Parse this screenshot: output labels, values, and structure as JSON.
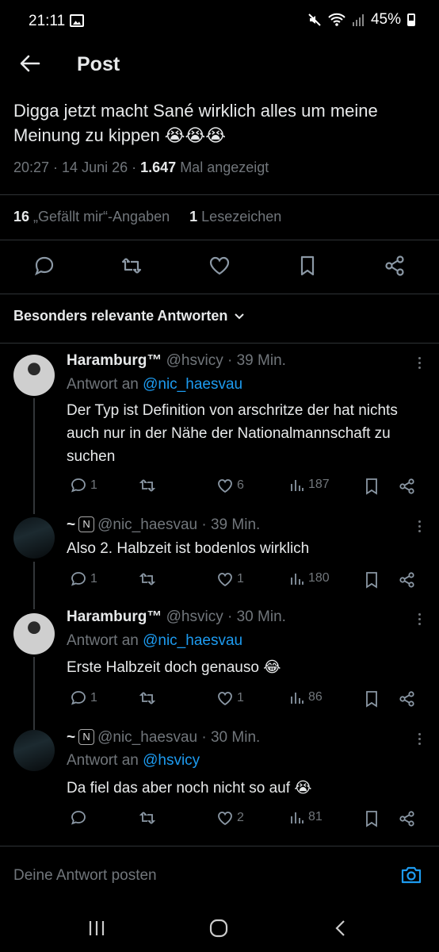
{
  "status_bar": {
    "time": "21:11",
    "battery": "45%"
  },
  "header": {
    "title": "Post"
  },
  "post": {
    "text": "Digga jetzt macht Sané wirklich alles um meine Meinung zu kippen 😭😭😭",
    "time": "20:27",
    "date": "14 Juni 26",
    "views_count": "1.647",
    "views_label": "Mal angezeigt",
    "likes_count": "16",
    "likes_label": "„Gefällt mir“-Angaben",
    "bookmarks_count": "1",
    "bookmarks_label": "Lesezeichen"
  },
  "sort": {
    "label": "Besonders relevante Antworten"
  },
  "replies": [
    {
      "name": "Haramburg™",
      "handle": "@hsvicy",
      "time": "· 39 Min.",
      "reply_to_label": "Antwort an",
      "reply_to": "@nic_haesvau",
      "text": "Der Typ ist Definition von arschritze der hat nichts auch nur in der Nähe der Nationalmannschaft zu suchen",
      "comments": "1",
      "retweets": "",
      "likes": "6",
      "views": "187"
    },
    {
      "name": "~",
      "badge": "N",
      "handle": "@nic_haesvau",
      "time": "· 39 Min.",
      "text": "Also 2. Halbzeit ist bodenlos wirklich",
      "comments": "1",
      "retweets": "",
      "likes": "1",
      "views": "180"
    },
    {
      "name": "Haramburg™",
      "handle": "@hsvicy",
      "time": "· 30 Min.",
      "reply_to_label": "Antwort an",
      "reply_to": "@nic_haesvau",
      "text": "Erste Halbzeit doch genauso 😂",
      "comments": "1",
      "retweets": "",
      "likes": "1",
      "views": "86"
    },
    {
      "name": "~",
      "badge": "N",
      "handle": "@nic_haesvau",
      "time": "· 30 Min.",
      "reply_to_label": "Antwort an",
      "reply_to": "@hsvicy",
      "text": "Da fiel das aber noch nicht so auf 😭",
      "comments": "",
      "retweets": "",
      "likes": "2",
      "views": "81"
    }
  ],
  "compose": {
    "placeholder": "Deine Antwort posten"
  },
  "icons": {
    "back": "arrow-left-icon",
    "comment": "comment-icon",
    "retweet": "retweet-icon",
    "like": "heart-icon",
    "bookmark": "bookmark-icon",
    "share": "share-icon",
    "views": "views-icon",
    "camera": "camera-icon"
  },
  "colors": {
    "background": "#000000",
    "text": "#e7e9ea",
    "muted": "#71767b",
    "link": "#1d9bf0",
    "divider": "#2f3336"
  }
}
